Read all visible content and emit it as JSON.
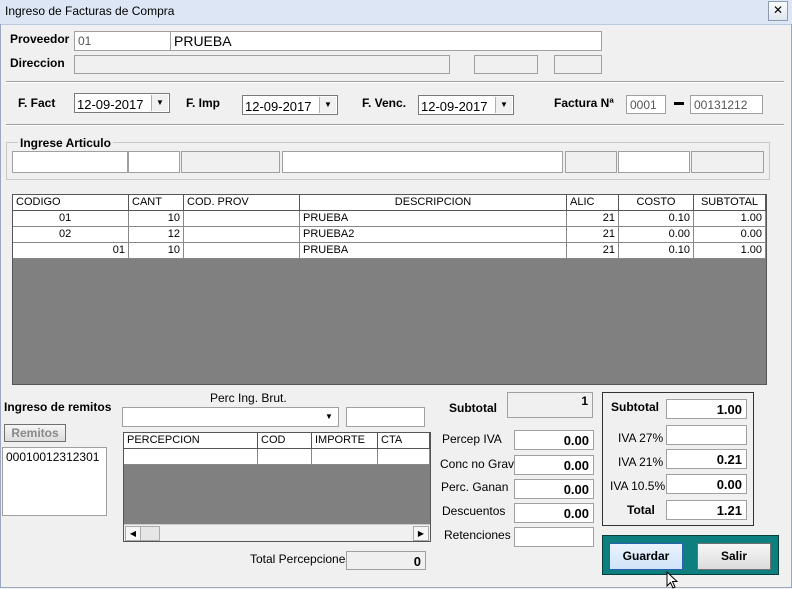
{
  "window": {
    "title": "Ingreso de Facturas de Compra",
    "close_glyph": "✕"
  },
  "proveedor": {
    "label": "Proveedor",
    "code": "01",
    "name": "PRUEBA"
  },
  "direccion": {
    "label": "Direccion"
  },
  "fechas": {
    "fact_label": "F. Fact",
    "fact_value": "12-09-2017",
    "imp_label": "F. Imp",
    "imp_value": "12-09-2017",
    "venc_label": "F. Venc.",
    "venc_value": "12-09-2017"
  },
  "factura": {
    "label": "Factura Nª",
    "punto": "0001",
    "numero": "00131212"
  },
  "articulo": {
    "label": "Ingrese Articulo"
  },
  "items_table": {
    "headers": [
      "CODIGO",
      "CANT",
      "COD. PROV",
      "DESCRIPCION",
      "ALIC",
      "COSTO",
      "SUBTOTAL"
    ],
    "rows": [
      [
        "01",
        "10",
        "",
        "PRUEBA",
        "21",
        "0.10",
        "1.00"
      ],
      [
        "02",
        "12",
        "",
        "PRUEBA2",
        "21",
        "0.00",
        "0.00"
      ],
      [
        "01",
        "10",
        "",
        "PRUEBA",
        "21",
        "0.10",
        "1.00"
      ]
    ]
  },
  "remitos": {
    "label": "Ingreso de remitos",
    "button": "Remitos",
    "items": [
      "00010012312301"
    ]
  },
  "percepciones": {
    "ingbrut_label": "Perc  Ing. Brut.",
    "headers": [
      "PERCEPCION",
      "COD",
      "IMPORTE",
      "CTA"
    ],
    "total_label": "Total Percepciones",
    "total_value": "0"
  },
  "subtotal_mid": {
    "label": "Subtotal",
    "value": "1"
  },
  "impuestos": {
    "percep_iva_label": "Percep  IVA",
    "percep_iva": "0.00",
    "conc_label": "Conc no Grav",
    "conc": "0.00",
    "ganan_label": "Perc. Ganan",
    "ganan": "0.00",
    "desc_label": "Descuentos",
    "desc": "0.00",
    "ret_label": "Retenciones",
    "ret": ""
  },
  "totales": {
    "subtotal_label": "Subtotal",
    "subtotal": "1.00",
    "iva27_label": "IVA 27%",
    "iva27": "",
    "iva21_label": "IVA 21%",
    "iva21": "0.21",
    "iva105_label": "IVA 10.5%",
    "iva105": "0.00",
    "total_label": "Total",
    "total": "1.21"
  },
  "actions": {
    "guardar": "Guardar",
    "salir": "Salir"
  },
  "colors": {
    "actions_panel": "#0e7f7f",
    "grid_bg": "#808080"
  }
}
